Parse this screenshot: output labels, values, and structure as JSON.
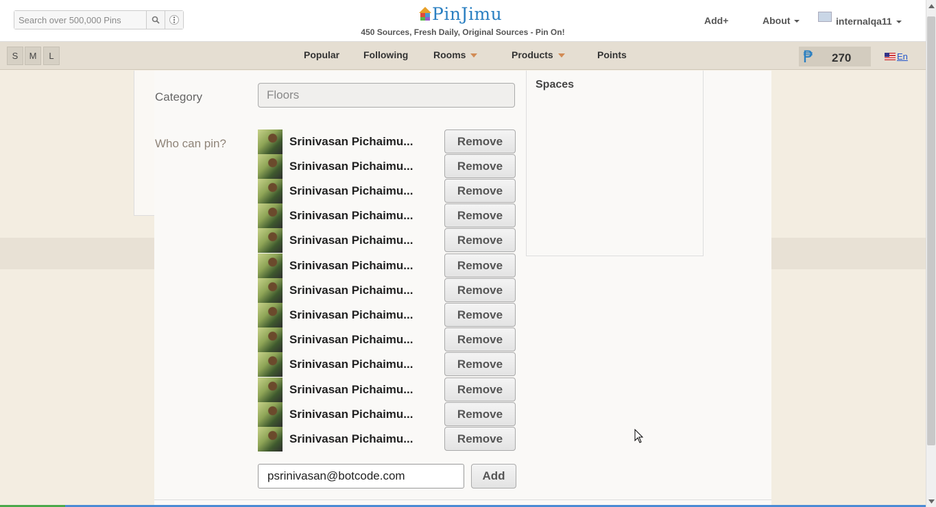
{
  "header": {
    "search_placeholder": "Search over 500,000 Pins",
    "logo_text": "PinJimu",
    "tagline": "450 Sources, Fresh Daily, Original Sources - Pin On!",
    "add_label": "Add+",
    "about_label": "About",
    "username": "internalqa11"
  },
  "navbar": {
    "sizes": [
      "S",
      "M",
      "L"
    ],
    "items": [
      {
        "label": "Popular",
        "dropdown": false
      },
      {
        "label": "Following",
        "dropdown": false
      },
      {
        "label": "Rooms",
        "dropdown": true
      },
      {
        "label": "Products",
        "dropdown": true
      },
      {
        "label": "Points",
        "dropdown": false
      }
    ],
    "points_symbol": "₱",
    "points_value": "270",
    "language": "En"
  },
  "modal": {
    "category_label": "Category",
    "category_value": "Floors",
    "who_can_pin_label": "Who can pin?",
    "pinners": [
      {
        "name": "Srinivasan Pichaimu..."
      },
      {
        "name": "Srinivasan Pichaimu..."
      },
      {
        "name": "Srinivasan Pichaimu..."
      },
      {
        "name": "Srinivasan Pichaimu..."
      },
      {
        "name": "Srinivasan Pichaimu..."
      },
      {
        "name": "Srinivasan Pichaimu..."
      },
      {
        "name": "Srinivasan Pichaimu..."
      },
      {
        "name": "Srinivasan Pichaimu..."
      },
      {
        "name": "Srinivasan Pichaimu..."
      },
      {
        "name": "Srinivasan Pichaimu..."
      },
      {
        "name": "Srinivasan Pichaimu..."
      },
      {
        "name": "Srinivasan Pichaimu..."
      },
      {
        "name": "Srinivasan Pichaimu..."
      }
    ],
    "remove_label": "Remove",
    "email_value": "psrinivasan@botcode.com",
    "add_label": "Add",
    "spaces_title": "Spaces"
  },
  "colors": {
    "brand_blue": "#2a7fc1",
    "background": "#f3ede1",
    "navbar": "#e5ded2",
    "accent_caret": "#d28b55"
  }
}
